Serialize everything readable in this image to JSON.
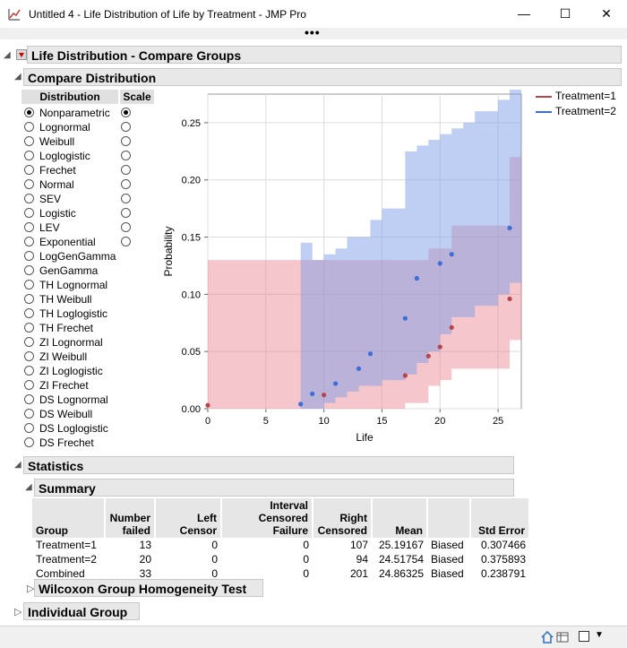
{
  "window": {
    "title": "Untitled 4 - Life Distribution of Life by Treatment - JMP Pro",
    "minimize": "—",
    "maximize": "☐",
    "close": "✕",
    "overflow_dots": "•••"
  },
  "report": {
    "title": "Life Distribution - Compare Groups",
    "compare_title": "Compare Distribution",
    "distribution_header": "Distribution",
    "scale_header": "Scale",
    "distributions": [
      {
        "label": "Nonparametric",
        "selected": true,
        "scale": true,
        "scale_selected": true
      },
      {
        "label": "Lognormal",
        "selected": false,
        "scale": true,
        "scale_selected": false
      },
      {
        "label": "Weibull",
        "selected": false,
        "scale": true,
        "scale_selected": false
      },
      {
        "label": "Loglogistic",
        "selected": false,
        "scale": true,
        "scale_selected": false
      },
      {
        "label": "Frechet",
        "selected": false,
        "scale": true,
        "scale_selected": false
      },
      {
        "label": "Normal",
        "selected": false,
        "scale": true,
        "scale_selected": false
      },
      {
        "label": "SEV",
        "selected": false,
        "scale": true,
        "scale_selected": false
      },
      {
        "label": "Logistic",
        "selected": false,
        "scale": true,
        "scale_selected": false
      },
      {
        "label": "LEV",
        "selected": false,
        "scale": true,
        "scale_selected": false
      },
      {
        "label": "Exponential",
        "selected": false,
        "scale": true,
        "scale_selected": false
      },
      {
        "label": "LogGenGamma",
        "selected": false,
        "scale": false
      },
      {
        "label": "GenGamma",
        "selected": false,
        "scale": false
      },
      {
        "label": "TH Lognormal",
        "selected": false,
        "scale": false
      },
      {
        "label": "TH Weibull",
        "selected": false,
        "scale": false
      },
      {
        "label": "TH Loglogistic",
        "selected": false,
        "scale": false
      },
      {
        "label": "TH Frechet",
        "selected": false,
        "scale": false
      },
      {
        "label": "ZI Lognormal",
        "selected": false,
        "scale": false
      },
      {
        "label": "ZI Weibull",
        "selected": false,
        "scale": false
      },
      {
        "label": "ZI Loglogistic",
        "selected": false,
        "scale": false
      },
      {
        "label": "ZI Frechet",
        "selected": false,
        "scale": false
      },
      {
        "label": "DS Lognormal",
        "selected": false,
        "scale": false
      },
      {
        "label": "DS Weibull",
        "selected": false,
        "scale": false
      },
      {
        "label": "DS Loglogistic",
        "selected": false,
        "scale": false
      },
      {
        "label": "DS Frechet",
        "selected": false,
        "scale": false
      }
    ],
    "statistics_title": "Statistics",
    "summary_title": "Summary",
    "summary": {
      "headers": [
        [
          "",
          "Group"
        ],
        [
          "Number",
          "failed"
        ],
        [
          "",
          "Left Censor"
        ],
        [
          "Interval",
          "Censored Failure"
        ],
        [
          "Right",
          "Censored"
        ],
        [
          "",
          "Mean"
        ],
        [
          "",
          ""
        ],
        [
          "",
          "Std Error"
        ]
      ],
      "rows": [
        [
          "Treatment=1",
          "13",
          "0",
          "0",
          "107",
          "25.19167",
          "Biased",
          "0.307466"
        ],
        [
          "Treatment=2",
          "20",
          "0",
          "0",
          "94",
          "24.51754",
          "Biased",
          "0.375893"
        ],
        [
          "Combined",
          "33",
          "0",
          "0",
          "201",
          "24.86325",
          "Biased",
          "0.238791"
        ]
      ]
    },
    "wilcoxon_title": "Wilcoxon Group Homogeneity Test",
    "individual_title": "Individual Group"
  },
  "chart_data": {
    "type": "step",
    "xlabel": "Life",
    "ylabel": "Probability",
    "xlim": [
      0,
      27
    ],
    "ylim": [
      0,
      0.275
    ],
    "xticks": [
      0,
      5,
      10,
      15,
      20,
      25
    ],
    "yticks": [
      0,
      0.05,
      0.1,
      0.15,
      0.2,
      0.25
    ],
    "grid": true,
    "legend_position": "right",
    "series": [
      {
        "name": "Treatment=1",
        "color": "#b8444c",
        "band_color": "#e8808c",
        "points": [
          [
            0,
            0.003
          ],
          [
            10,
            0.012
          ],
          [
            17,
            0.029
          ],
          [
            19,
            0.046
          ],
          [
            20,
            0.054
          ],
          [
            21,
            0.071
          ],
          [
            26,
            0.096
          ]
        ],
        "band_x": [
          0,
          8,
          10,
          17,
          19,
          20,
          21,
          26,
          27
        ],
        "band_lower": [
          0,
          0,
          0,
          0.005,
          0.02,
          0.025,
          0.035,
          0.06,
          0.06
        ],
        "band_upper": [
          0.13,
          0.13,
          0.13,
          0.13,
          0.14,
          0.14,
          0.16,
          0.22,
          0.22
        ]
      },
      {
        "name": "Treatment=2",
        "color": "#3a6fd8",
        "band_color": "#7f9ee8",
        "points": [
          [
            8,
            0.004
          ],
          [
            9,
            0.013
          ],
          [
            11,
            0.022
          ],
          [
            13,
            0.035
          ],
          [
            14,
            0.048
          ],
          [
            17,
            0.079
          ],
          [
            18,
            0.114
          ],
          [
            20,
            0.127
          ],
          [
            21,
            0.135
          ],
          [
            26,
            0.158
          ]
        ],
        "band_x": [
          8,
          9,
          10,
          11,
          12,
          13,
          14,
          15,
          17,
          18,
          19,
          20,
          21,
          22,
          23,
          25,
          26,
          27
        ],
        "band_lower": [
          0,
          0,
          0.005,
          0.01,
          0.015,
          0.02,
          0.02,
          0.025,
          0.03,
          0.04,
          0.05,
          0.065,
          0.08,
          0.08,
          0.09,
          0.1,
          0.11,
          0.11
        ],
        "band_upper": [
          0.145,
          0.13,
          0.135,
          0.14,
          0.15,
          0.15,
          0.165,
          0.175,
          0.225,
          0.23,
          0.235,
          0.24,
          0.245,
          0.25,
          0.26,
          0.27,
          0.28,
          0.28
        ]
      }
    ]
  }
}
